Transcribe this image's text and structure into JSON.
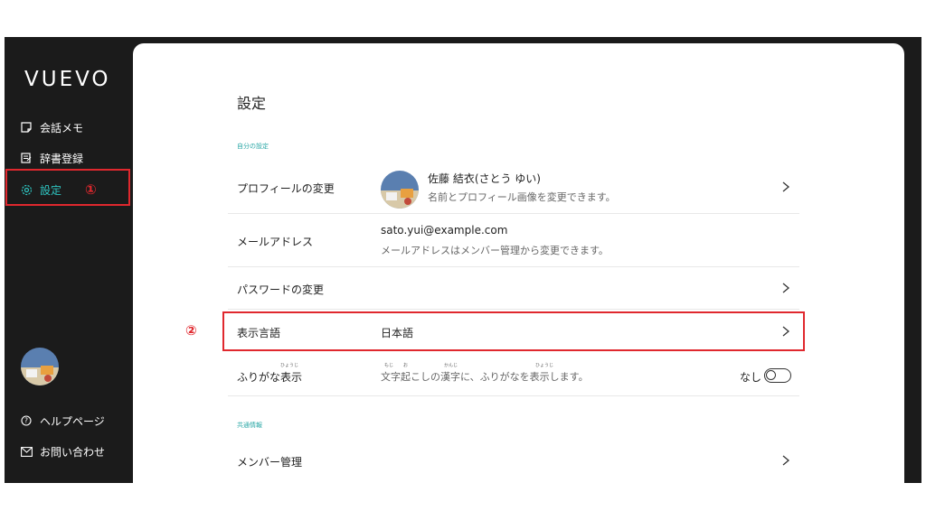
{
  "app": {
    "brand": "VUEVO"
  },
  "sidebar": {
    "items": [
      {
        "label": "会話メモ",
        "icon": "memo-icon"
      },
      {
        "label": "辞書登録",
        "icon": "dictionary-icon"
      },
      {
        "label": "設定",
        "icon": "gear-icon",
        "active": true
      }
    ],
    "annotation_1": "①",
    "help": "ヘルプページ",
    "contact": "お問い合わせ"
  },
  "settings": {
    "title": "設定",
    "section_personal": "自分の設定",
    "profile": {
      "label": "プロフィールの変更",
      "name": "佐藤 結衣(さとう ゆい)",
      "desc": "名前とプロフィール画像を変更できます。"
    },
    "email": {
      "label": "メールアドレス",
      "value": "sato.yui@example.com",
      "desc": "メールアドレスはメンバー管理から変更できます。"
    },
    "password": {
      "label": "パスワードの変更"
    },
    "language": {
      "label": "表示言語",
      "value": "日本語"
    },
    "annotation_2": "②",
    "furigana": {
      "label_prefix": "ふりがな",
      "label_kanji": "表示",
      "label_ruby": "ひょうじ",
      "desc_kanji1": "文字",
      "desc_ruby1": "もじ",
      "desc_kanji2": "起",
      "desc_ruby2": "お",
      "desc_mid": "こしの",
      "desc_kanji3": "漢字",
      "desc_ruby3": "かんじ",
      "desc_mid2": "に、ふりがなを",
      "desc_kanji4": "表示",
      "desc_ruby4": "ひょうじ",
      "desc_end": "します。",
      "toggle_label": "なし",
      "toggle_on": false
    },
    "section_shared": "共通情報",
    "members": {
      "label": "メンバー管理"
    }
  },
  "colors": {
    "accent": "#2ec4c0",
    "highlight": "#e0282e",
    "sidebar_bg": "#1b1b1b"
  }
}
